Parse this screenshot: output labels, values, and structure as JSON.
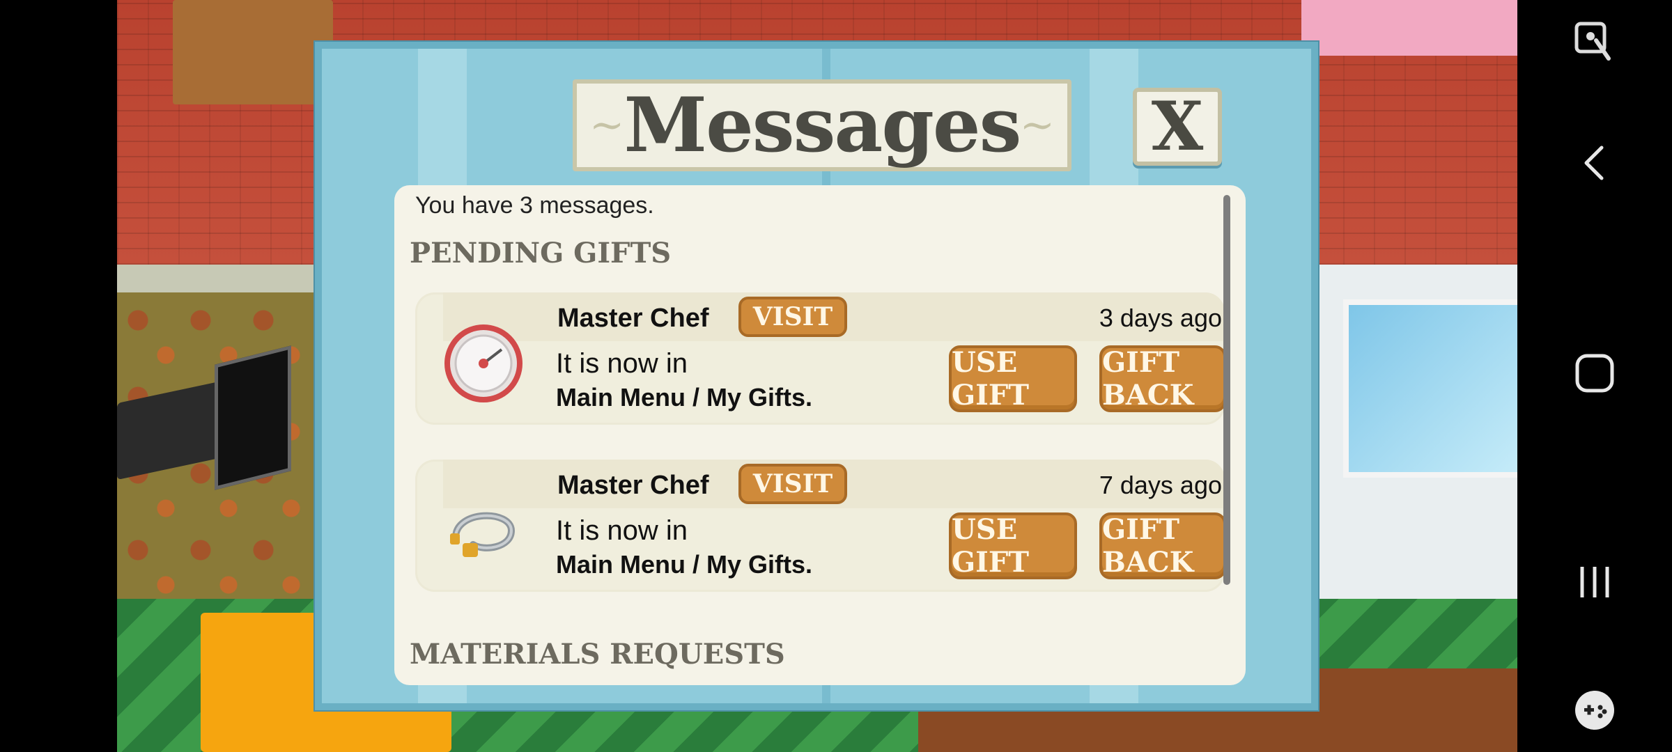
{
  "dialog": {
    "title": "Messages",
    "close_label": "X",
    "message_count": "You have 3 messages.",
    "pending_title": "PENDING GIFTS",
    "materials_title": "MATERIALS REQUESTS",
    "gifts": [
      {
        "sender": "Master Chef",
        "visit_label": "VISIT",
        "time_ago": "3 days ago",
        "line1": "It is now in",
        "line2": "Main Menu / My Gifts.",
        "use_label": "USE GIFT",
        "back_label": "GIFT BACK",
        "icon": "gauge-icon"
      },
      {
        "sender": "Master Chef",
        "visit_label": "VISIT",
        "time_ago": "7 days ago",
        "line1": "It is now in",
        "line2": "Main Menu / My Gifts.",
        "use_label": "USE GIFT",
        "back_label": "GIFT BACK",
        "icon": "gas-hose-icon"
      }
    ]
  },
  "system_nav": {
    "buttons": [
      "screen-lock-icon",
      "back-icon",
      "home-icon",
      "recents-icon",
      "game-launcher-icon"
    ]
  },
  "colors": {
    "dialog_bg": "#8ecbdb",
    "panel_bg": "#f5f3e8",
    "button_orange": "#cf8a3a"
  }
}
